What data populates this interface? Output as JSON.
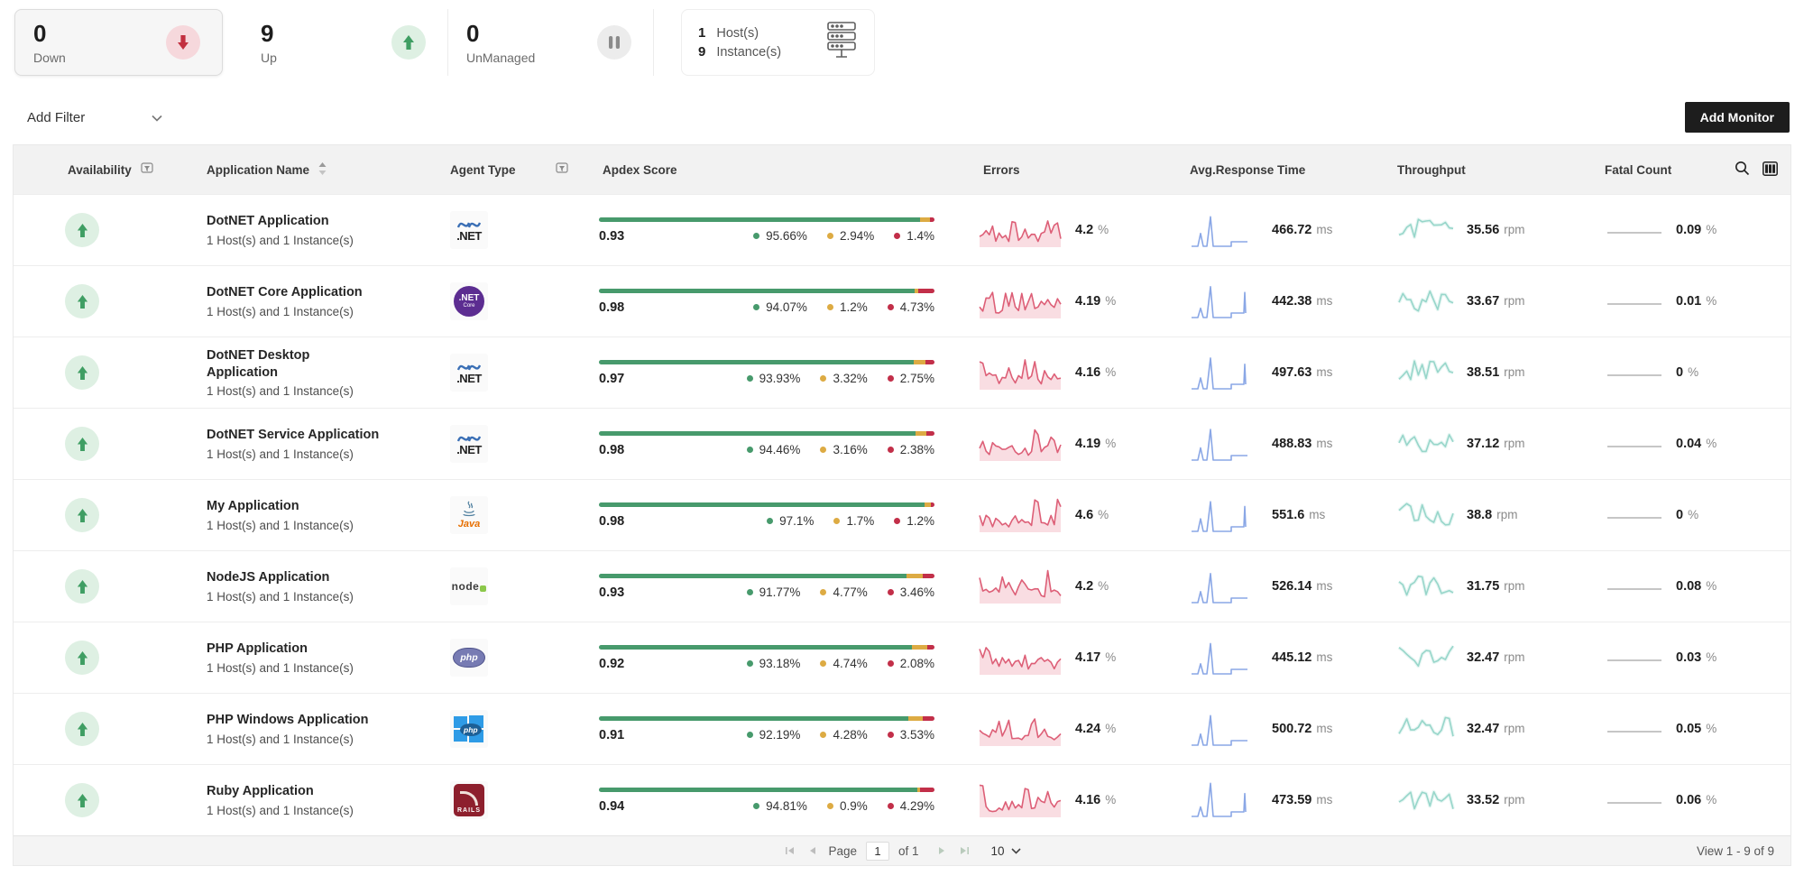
{
  "summary": {
    "cards": [
      {
        "value": "0",
        "label": "Down",
        "icon": "down-arrow"
      },
      {
        "value": "9",
        "label": "Up",
        "icon": "up-arrow"
      },
      {
        "value": "0",
        "label": "UnManaged",
        "icon": "pause"
      },
      {
        "icon": "hosts-stack",
        "rows": [
          {
            "value": "1",
            "label": "Host(s)"
          },
          {
            "value": "9",
            "label": "Instance(s)"
          }
        ]
      }
    ]
  },
  "toolbar": {
    "add_filter_label": "Add Filter",
    "add_monitor_label": "Add Monitor"
  },
  "table": {
    "columns": [
      "Availability",
      "Application Name",
      "Agent Type",
      "Apdex Score",
      "Errors",
      "Avg.Response Time",
      "Throughput",
      "Fatal Count"
    ],
    "rows": [
      {
        "name": "DotNET Application",
        "subtitle": "1 Host(s) and 1 Instance(s)",
        "agent": "dotnet",
        "apdex": {
          "score": "0.93",
          "satisfied": "95.66%",
          "tolerating": "2.94%",
          "frustrated": "1.4%"
        },
        "errors": "4.2",
        "errors_unit": "%",
        "response": "466.72",
        "response_unit": "ms",
        "throughput": "35.56",
        "throughput_unit": "rpm",
        "fatal": "0.09",
        "fatal_unit": "%"
      },
      {
        "name": "DotNET Core Application",
        "subtitle": "1 Host(s) and 1 Instance(s)",
        "agent": "dotnet-core",
        "apdex": {
          "score": "0.98",
          "satisfied": "94.07%",
          "tolerating": "1.2%",
          "frustrated": "4.73%"
        },
        "errors": "4.19",
        "errors_unit": "%",
        "response": "442.38",
        "response_unit": "ms",
        "throughput": "33.67",
        "throughput_unit": "rpm",
        "fatal": "0.01",
        "fatal_unit": "%"
      },
      {
        "name": "DotNET Desktop Application",
        "name_lines": [
          "DotNET Desktop",
          "Application"
        ],
        "subtitle": "1 Host(s) and 1 Instance(s)",
        "agent": "dotnet",
        "apdex": {
          "score": "0.97",
          "satisfied": "93.93%",
          "tolerating": "3.32%",
          "frustrated": "2.75%"
        },
        "errors": "4.16",
        "errors_unit": "%",
        "response": "497.63",
        "response_unit": "ms",
        "throughput": "38.51",
        "throughput_unit": "rpm",
        "fatal": "0",
        "fatal_unit": "%"
      },
      {
        "name": "DotNET Service Application",
        "subtitle": "1 Host(s) and 1 Instance(s)",
        "agent": "dotnet",
        "apdex": {
          "score": "0.98",
          "satisfied": "94.46%",
          "tolerating": "3.16%",
          "frustrated": "2.38%"
        },
        "errors": "4.19",
        "errors_unit": "%",
        "response": "488.83",
        "response_unit": "ms",
        "throughput": "37.12",
        "throughput_unit": "rpm",
        "fatal": "0.04",
        "fatal_unit": "%"
      },
      {
        "name": "My Application",
        "subtitle": "1 Host(s) and 1 Instance(s)",
        "agent": "java",
        "apdex": {
          "score": "0.98",
          "satisfied": "97.1%",
          "tolerating": "1.7%",
          "frustrated": "1.2%"
        },
        "errors": "4.6",
        "errors_unit": "%",
        "response": "551.6",
        "response_unit": "ms",
        "throughput": "38.8",
        "throughput_unit": "rpm",
        "fatal": "0",
        "fatal_unit": "%"
      },
      {
        "name": "NodeJS Application",
        "subtitle": "1 Host(s) and 1 Instance(s)",
        "agent": "node",
        "apdex": {
          "score": "0.93",
          "satisfied": "91.77%",
          "tolerating": "4.77%",
          "frustrated": "3.46%"
        },
        "errors": "4.2",
        "errors_unit": "%",
        "response": "526.14",
        "response_unit": "ms",
        "throughput": "31.75",
        "throughput_unit": "rpm",
        "fatal": "0.08",
        "fatal_unit": "%"
      },
      {
        "name": "PHP Application",
        "subtitle": "1 Host(s) and 1 Instance(s)",
        "agent": "php",
        "apdex": {
          "score": "0.92",
          "satisfied": "93.18%",
          "tolerating": "4.74%",
          "frustrated": "2.08%"
        },
        "errors": "4.17",
        "errors_unit": "%",
        "response": "445.12",
        "response_unit": "ms",
        "throughput": "32.47",
        "throughput_unit": "rpm",
        "fatal": "0.03",
        "fatal_unit": "%"
      },
      {
        "name": "PHP Windows Application",
        "subtitle": "1 Host(s) and 1 Instance(s)",
        "agent": "php-windows",
        "apdex": {
          "score": "0.91",
          "satisfied": "92.19%",
          "tolerating": "4.28%",
          "frustrated": "3.53%"
        },
        "errors": "4.24",
        "errors_unit": "%",
        "response": "500.72",
        "response_unit": "ms",
        "throughput": "32.47",
        "throughput_unit": "rpm",
        "fatal": "0.05",
        "fatal_unit": "%"
      },
      {
        "name": "Ruby Application",
        "subtitle": "1 Host(s) and 1 Instance(s)",
        "agent": "rails",
        "apdex": {
          "score": "0.94",
          "satisfied": "94.81%",
          "tolerating": "0.9%",
          "frustrated": "4.29%"
        },
        "errors": "4.16",
        "errors_unit": "%",
        "response": "473.59",
        "response_unit": "ms",
        "throughput": "33.52",
        "throughput_unit": "rpm",
        "fatal": "0.06",
        "fatal_unit": "%"
      }
    ]
  },
  "agent_icons": {
    "dotnet": ".NET",
    "dotnet_core_main": ".NET",
    "dotnet_core_sub": "Core",
    "java": "Java",
    "node": "node",
    "php": "php",
    "php_windows": "php",
    "rails": "RAILS"
  },
  "pagination": {
    "page_label": "Page",
    "page_value": "1",
    "of_label": "of 1",
    "page_size": "10",
    "view_status": "View 1 - 9 of 9"
  },
  "colors": {
    "apdex_green": "#479a6c",
    "apdex_yellow": "#ddab43",
    "apdex_red": "#c22f49",
    "errors_spark": "#dd5f77",
    "response_spark": "#8aa7e6",
    "throughput_spark": "#77c9ba",
    "fatal_line": "#a5a5a5",
    "up_green": "#3f9e63",
    "down_red": "#c22f3f",
    "add_monitor_bg": "#1d1d1d",
    "header_bg": "#f2f2f2"
  }
}
